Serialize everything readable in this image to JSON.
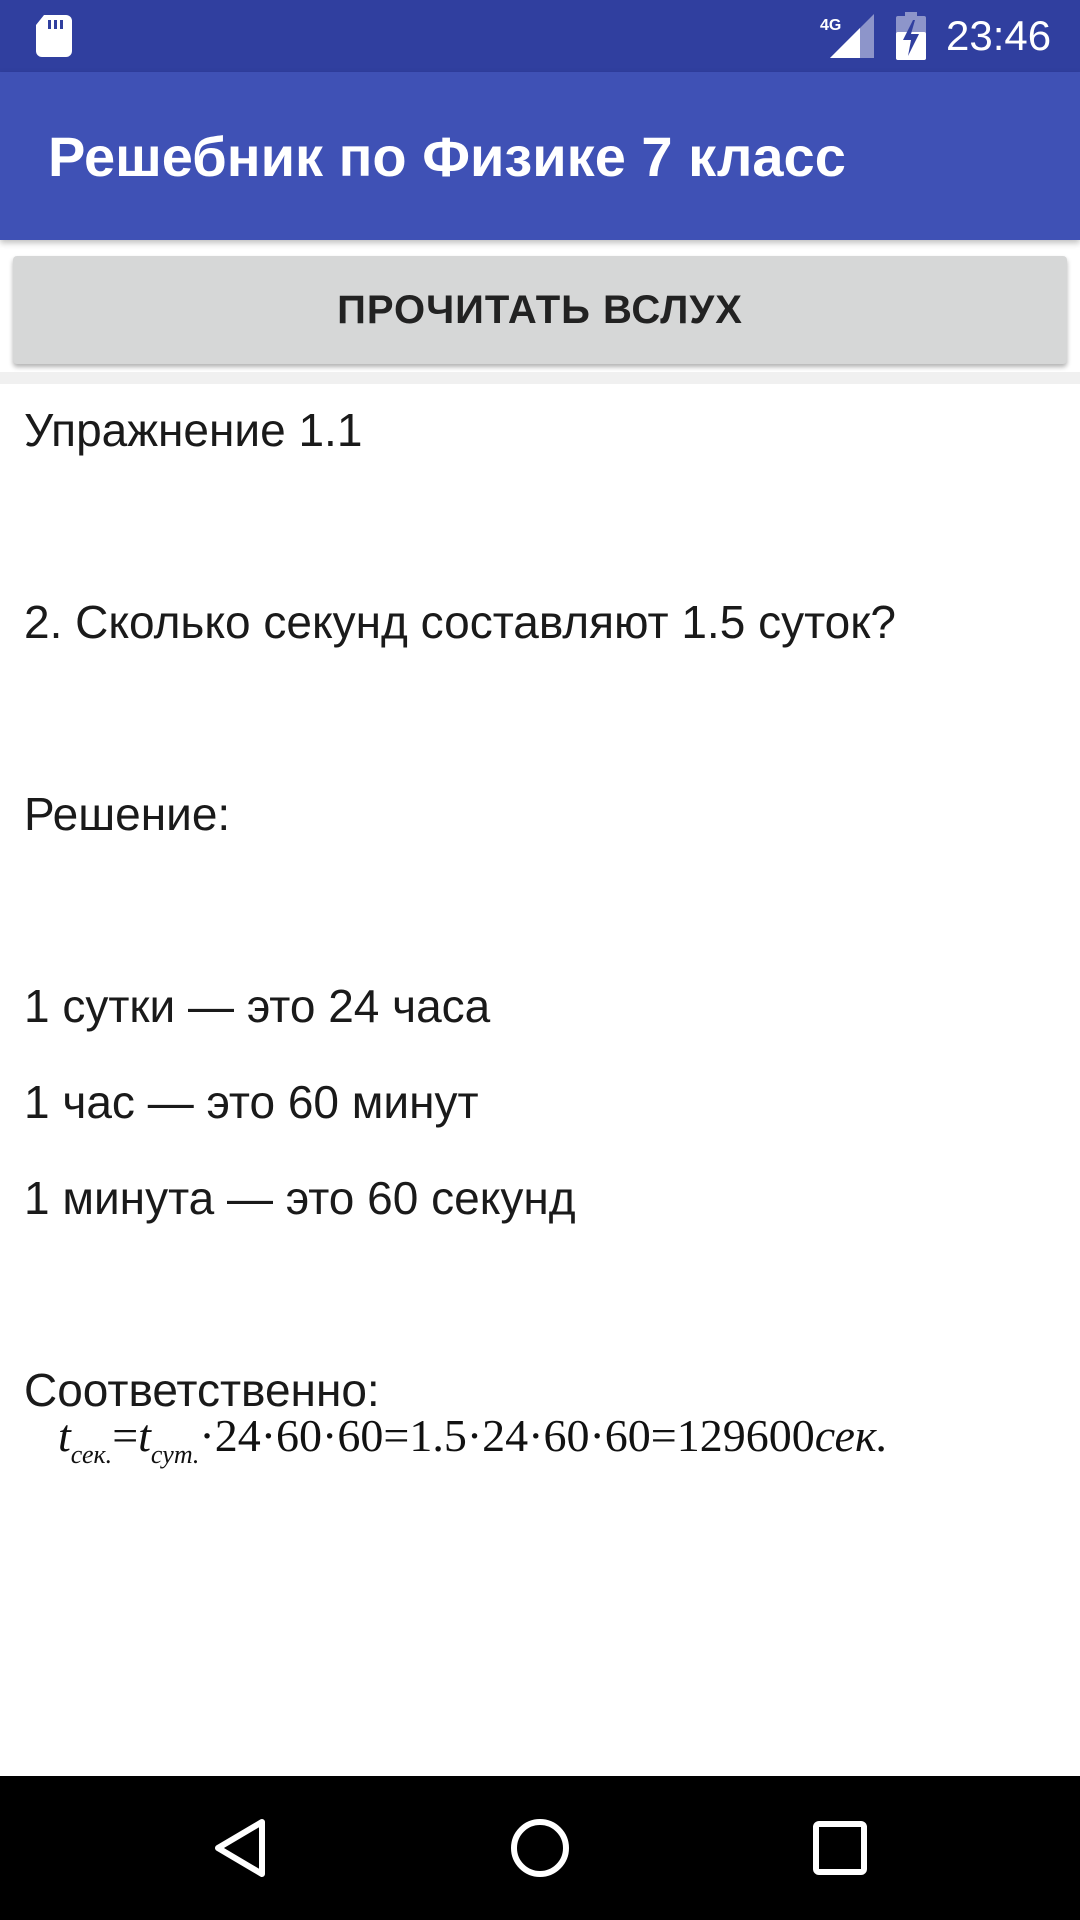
{
  "status_bar": {
    "network": "4G",
    "time": "23:46"
  },
  "app_bar": {
    "title": "Решебник по Физике 7 класс"
  },
  "actions": {
    "read_aloud": "ПРОЧИТАТЬ ВСЛУХ"
  },
  "content": {
    "exercise": "Упражнение 1.1",
    "question": "2. Сколько секунд составляют 1.5 суток?",
    "solution_label": "Решение:",
    "facts": [
      "1 сутки — это 24 часа",
      "1 час — это 60 минут",
      "1 минута — это 60 секунд"
    ],
    "conclusion_label": "Соответственно:",
    "formula": {
      "t": "t",
      "sub_sec": "сек.",
      "eq": "=",
      "sub_day": "сут.",
      "expr": "·24·60·60=1.5·24·60·60=129600",
      "unit": "сек."
    }
  },
  "nav": {
    "back_icon": "back-triangle",
    "home_icon": "home-circle",
    "recents_icon": "recents-square"
  },
  "colors": {
    "status_bar": "#303f9f",
    "app_bar": "#3f51b5",
    "button_bg": "#d6d7d7"
  }
}
